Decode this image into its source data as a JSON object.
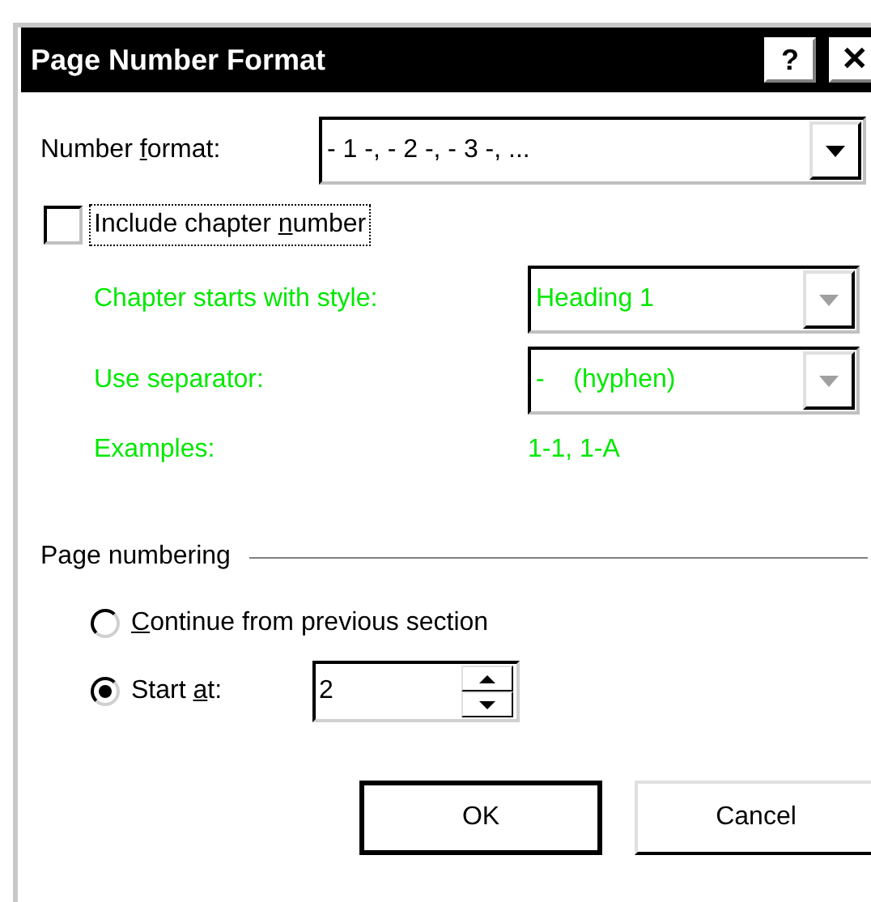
{
  "window": {
    "title": "Page Number Format",
    "buttons": [
      {
        "kind": "help",
        "label": "?"
      },
      {
        "kind": "close",
        "label": "✕"
      }
    ]
  },
  "number_format": {
    "label_parts": [
      {
        "text": "Number ",
        "underline": false
      },
      {
        "text": "f",
        "underline": true
      },
      {
        "text": "ormat:",
        "underline": false
      }
    ],
    "value": "- 1 -, - 2 -, - 3 -, ..."
  },
  "include_chapter": {
    "label_parts": [
      {
        "text": "Include chapter ",
        "underline": false
      },
      {
        "text": "n",
        "underline": true
      },
      {
        "text": "umber",
        "underline": false
      }
    ],
    "checked": false,
    "focused": true
  },
  "chapter": {
    "disabled": true,
    "style": {
      "label": "Chapter starts with style:",
      "value": "Heading 1"
    },
    "separator": {
      "label": "Use separator:",
      "value": "-    (hyphen)"
    },
    "examples": {
      "label": "Examples:",
      "value": "1-1, 1-A"
    }
  },
  "page_numbering": {
    "title": "Page numbering",
    "options": [
      {
        "label_parts": [
          {
            "text": "C",
            "underline": true
          },
          {
            "text": "ontinue from previous section",
            "underline": false
          }
        ],
        "selected": false
      },
      {
        "label_parts": [
          {
            "text": "Start ",
            "underline": false
          },
          {
            "text": "a",
            "underline": true
          },
          {
            "text": "t:",
            "underline": false
          }
        ],
        "selected": true
      }
    ],
    "start_at": "2"
  },
  "buttons": [
    {
      "label": "OK",
      "default": true
    },
    {
      "label": "Cancel",
      "default": false
    }
  ]
}
